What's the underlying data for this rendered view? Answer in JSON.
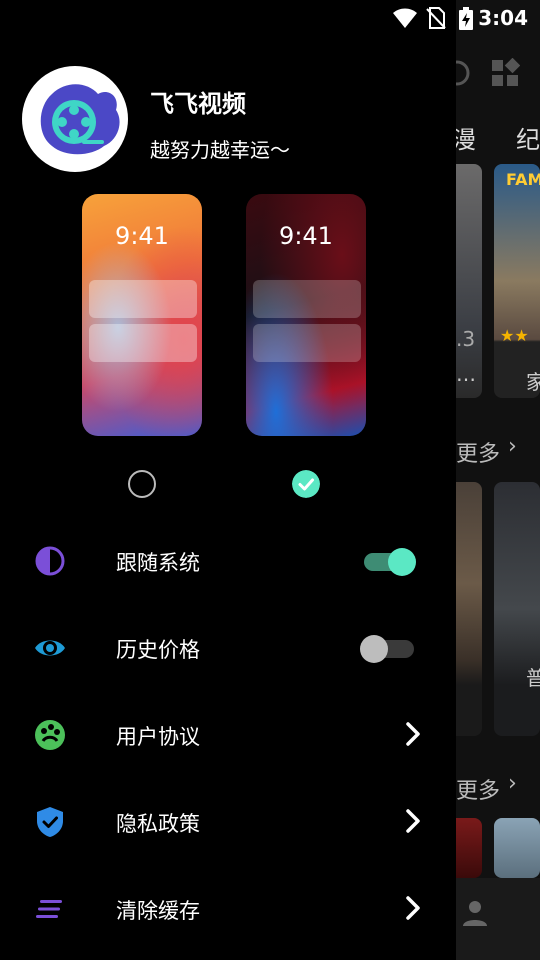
{
  "status_bar": {
    "time": "3:04"
  },
  "drawer": {
    "app_name": "飞飞视频",
    "slogan": "越努力越幸运～",
    "themes": [
      {
        "clock": "9:41",
        "selected": false
      },
      {
        "clock": "9:41",
        "selected": true
      }
    ],
    "menu": [
      {
        "label": "跟随系统",
        "icon": "half-moon-icon",
        "control": "toggle",
        "on": true
      },
      {
        "label": "历史价格",
        "icon": "eye-icon",
        "control": "toggle",
        "on": false
      },
      {
        "label": "用户协议",
        "icon": "palette-icon",
        "control": "chevron"
      },
      {
        "label": "隐私政策",
        "icon": "shield-check-icon",
        "control": "chevron"
      },
      {
        "label": "清除缓存",
        "icon": "lines-icon",
        "control": "chevron"
      }
    ]
  },
  "background": {
    "tabs": [
      "漫",
      "纪"
    ],
    "more_label_1": "更多",
    "more_label_2": "更多",
    "poster_text": "FAM",
    "rating_fragment": ".3",
    "caption_fragment": "家",
    "caption_fragment_2": "普"
  },
  "colors": {
    "accent": "#5BE8C4",
    "toggle_track_on": "#3E8C74",
    "toggle_off_track": "#3a3a3a",
    "purple": "#7B4FD8",
    "blue": "#1E9BD6",
    "green": "#4CC05A",
    "shield": "#2F8BE6"
  }
}
